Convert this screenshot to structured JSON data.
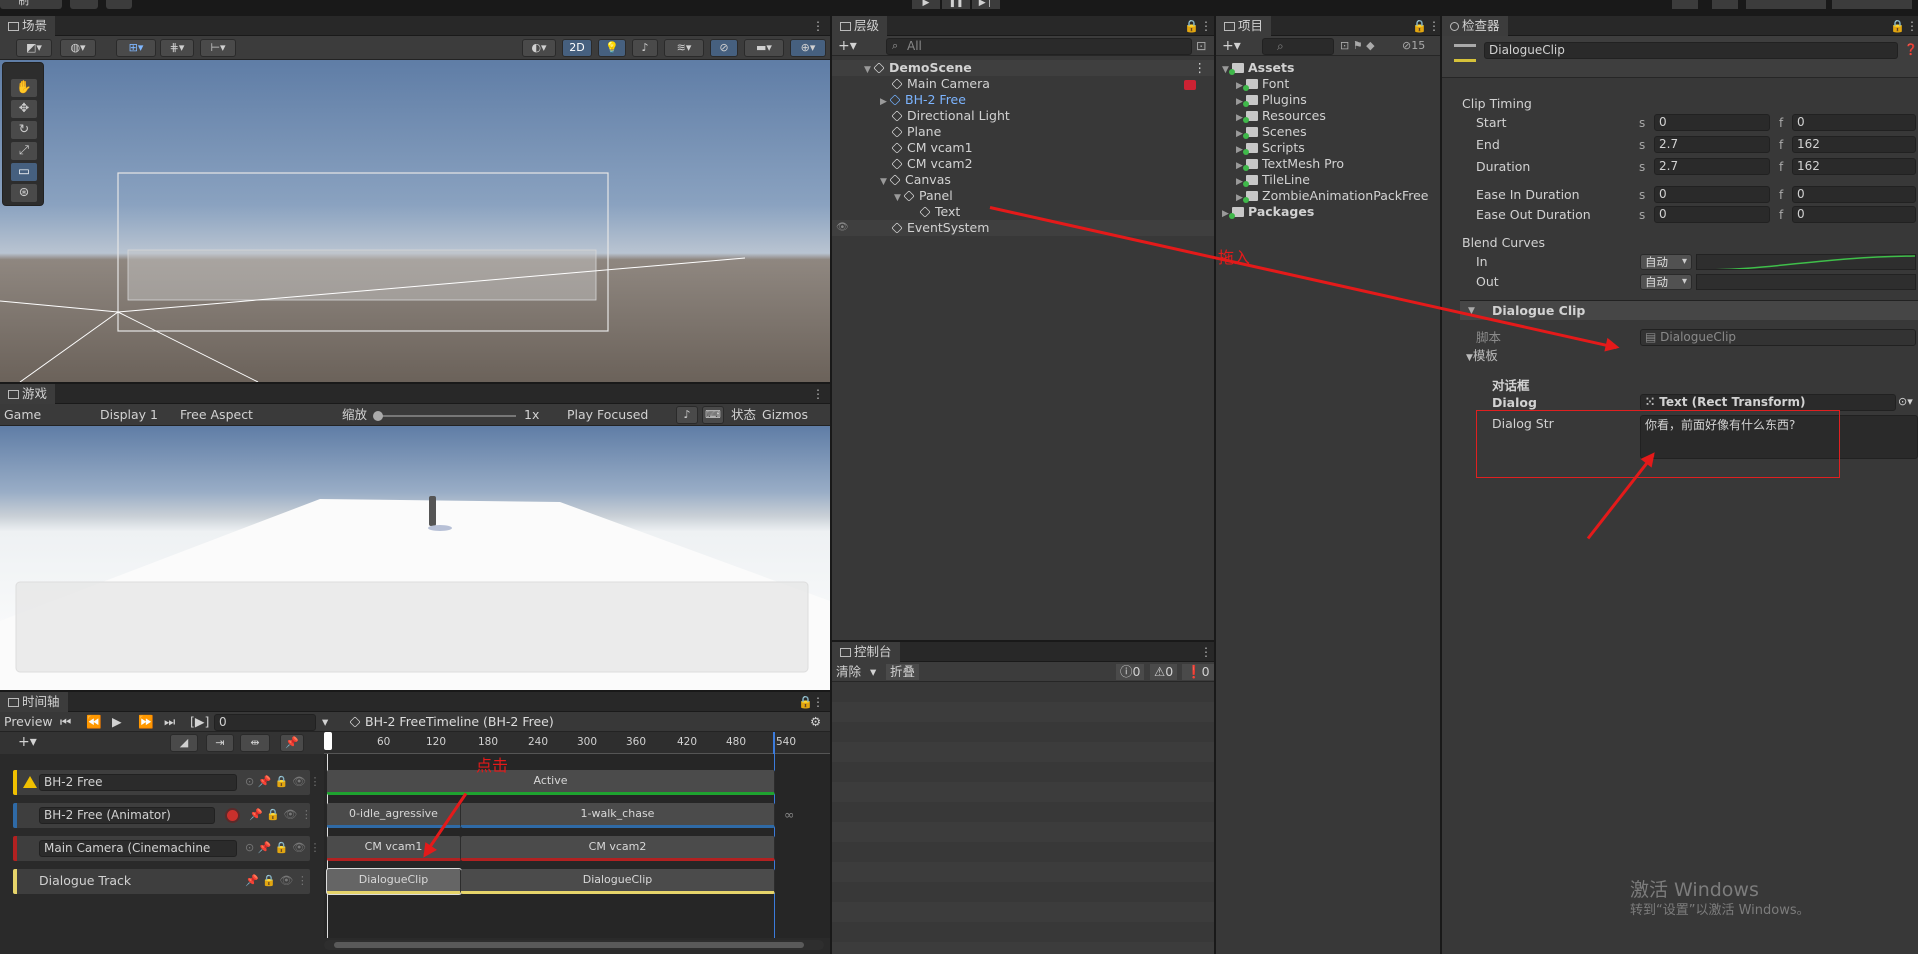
{
  "top": {
    "left_label": "制"
  },
  "scene": {
    "tab": "场景",
    "btn_2d": "2D"
  },
  "game": {
    "tab": "游戏",
    "mode": "Game",
    "display": "Display 1",
    "aspect": "Free Aspect",
    "scale_label": "缩放",
    "scale_value": "1x",
    "play_mode": "Play Focused",
    "stats": "状态",
    "gizmos": "Gizmos"
  },
  "hierarchy": {
    "tab": "层级",
    "search_placeholder": "All",
    "scene_name": "DemoScene",
    "items": [
      {
        "label": "Main Camera"
      },
      {
        "label": "BH-2 Free"
      },
      {
        "label": "Directional Light"
      },
      {
        "label": "Plane"
      },
      {
        "label": "CM vcam1"
      },
      {
        "label": "CM vcam2"
      },
      {
        "label": "Canvas"
      },
      {
        "label": "Panel"
      },
      {
        "label": "Text"
      },
      {
        "label": "EventSystem"
      }
    ]
  },
  "project": {
    "tab": "项目",
    "count": "15",
    "root": "Assets",
    "folders": [
      "Font",
      "Plugins",
      "Resources",
      "Scenes",
      "Scripts",
      "TextMesh Pro",
      "TileLine",
      "ZombieAnimationPackFree"
    ],
    "packages": "Packages"
  },
  "console": {
    "tab": "控制台",
    "clear": "清除",
    "collapse": "折叠",
    "errors": "0",
    "warnings": "0",
    "infos": "0"
  },
  "inspector": {
    "tab": "检查器",
    "object_name": "DialogueClip",
    "clip_timing": "Clip Timing",
    "rows": [
      {
        "label": "Start",
        "s": "0",
        "f": "0"
      },
      {
        "label": "End",
        "s": "2.7",
        "f": "162"
      },
      {
        "label": "Duration",
        "s": "2.7",
        "f": "162"
      },
      {
        "label": "Ease In Duration",
        "s": "0",
        "f": "0"
      },
      {
        "label": "Ease Out Duration",
        "s": "0",
        "f": "0"
      }
    ],
    "s_label": "s",
    "f_label": "f",
    "blend_curves": "Blend Curves",
    "in": "In",
    "out": "Out",
    "auto": "自动",
    "component": "Dialogue Clip",
    "script_label": "脚本",
    "script_value": "DialogueClip",
    "template_label": "模板",
    "dialog_header": "对话框",
    "dialog_label": "Dialog",
    "dialog_value": "Text (Rect Transform)",
    "dialog_str_label": "Dialog Str",
    "dialog_str_value": "你看，前面好像有什么东西?"
  },
  "annotations": {
    "drag_in": "拖入",
    "click": "点击"
  },
  "timeline": {
    "tab": "时间轴",
    "preview": "Preview",
    "frame": "0",
    "asset": "BH-2 FreeTimeline (BH-2 Free)",
    "ruler": [
      "60",
      "120",
      "180",
      "240",
      "300",
      "360",
      "420",
      "480",
      "540"
    ],
    "tracks": [
      {
        "name": "BH-2 Free",
        "color": "#f0c000"
      },
      {
        "name": "BH-2 Free (Animator)",
        "color": "#2f6aa6"
      },
      {
        "name": "Main Camera (Cinemachine",
        "color": "#b22121"
      },
      {
        "name": "Dialogue Track",
        "color": "#e6d46a"
      }
    ],
    "clips": {
      "active": "Active",
      "idle": "0-idle_agressive",
      "walk": "1-walk_chase",
      "vcam1": "CM vcam1",
      "vcam2": "CM vcam2",
      "dialogue1": "DialogueClip",
      "dialogue2": "DialogueClip"
    }
  },
  "watermark": {
    "line1": "激活 Windows",
    "line2": "转到“设置”以激活 Windows。"
  }
}
